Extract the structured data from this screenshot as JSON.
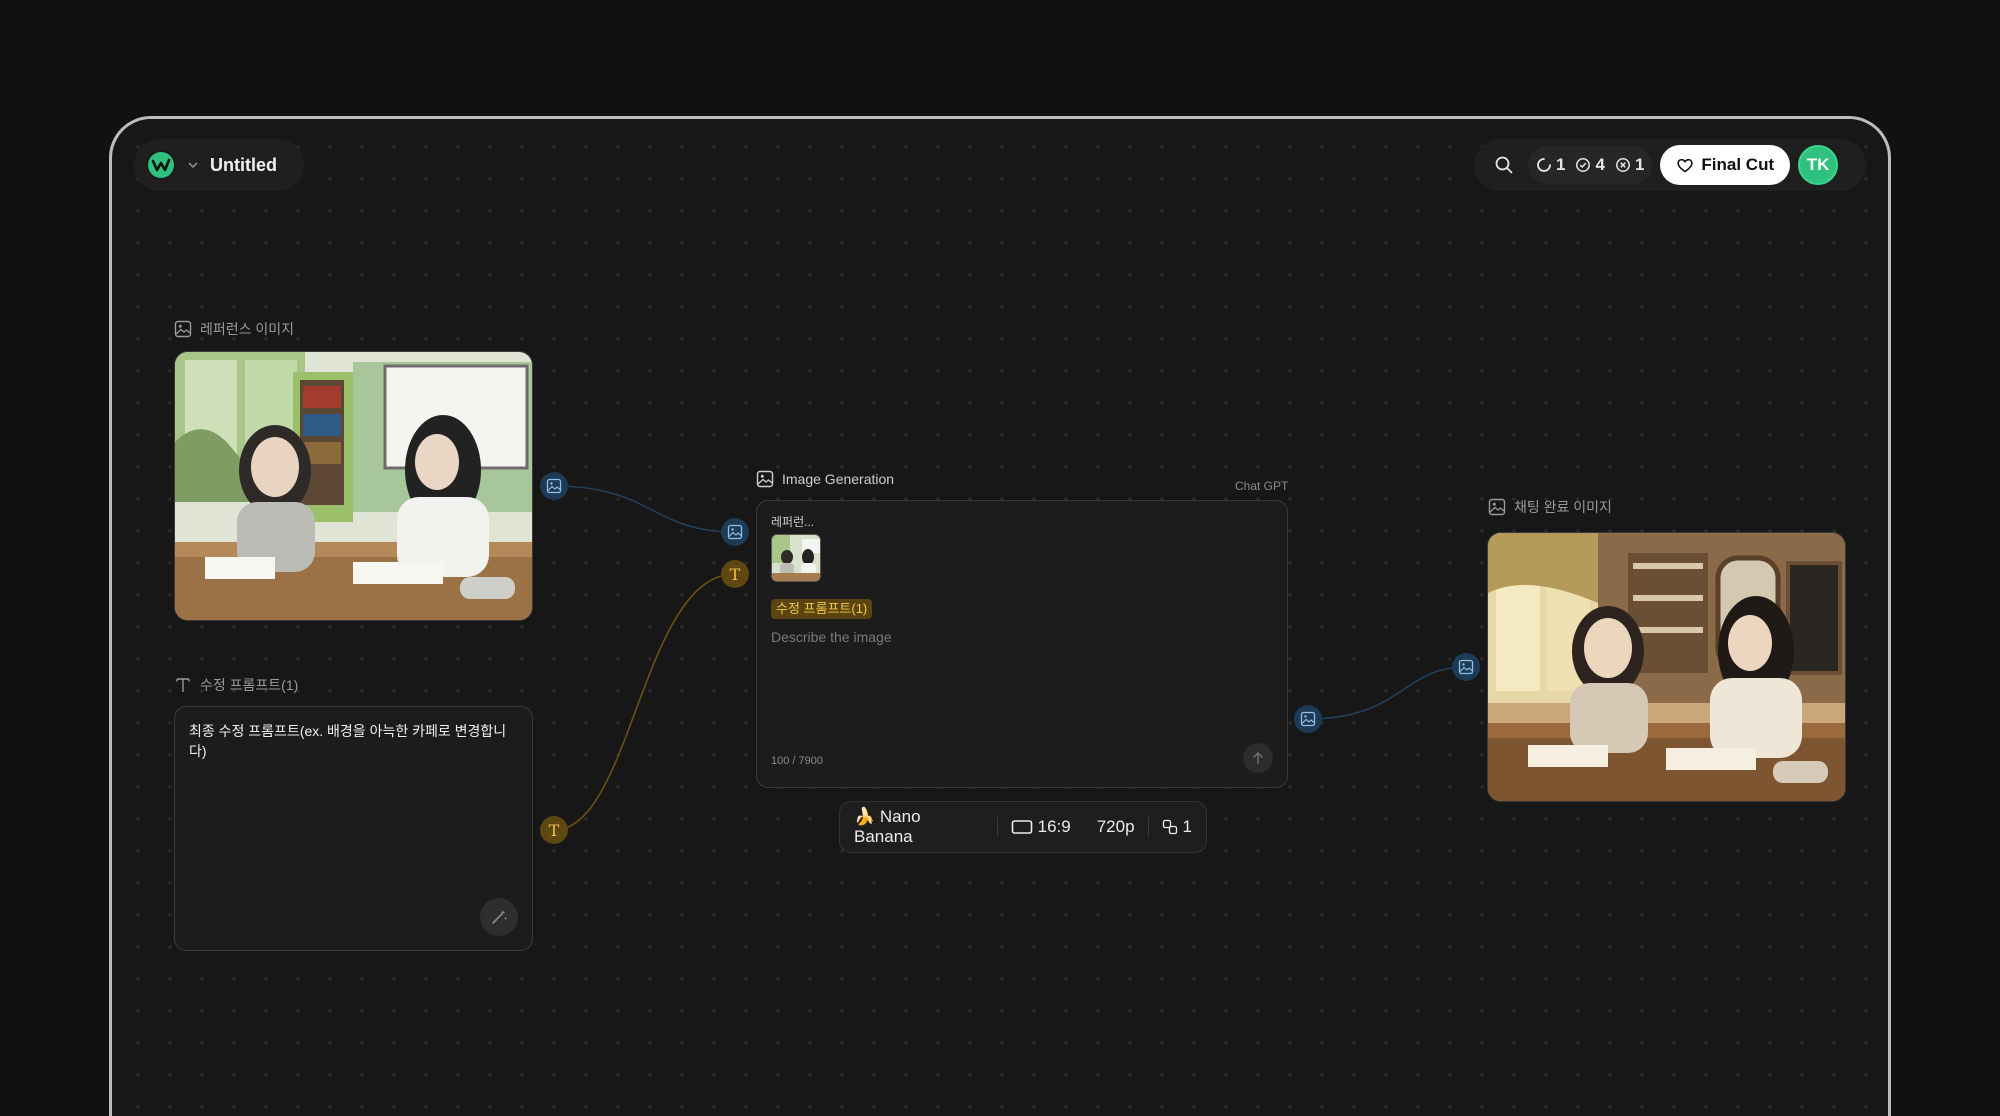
{
  "header": {
    "project_title": "Untitled",
    "stats": [
      {
        "icon": "loading-icon",
        "value": "1"
      },
      {
        "icon": "check-circle-icon",
        "value": "4"
      },
      {
        "icon": "x-circle-icon",
        "value": "1"
      }
    ],
    "final_cut_label": "Final Cut",
    "avatar_initials": "TK"
  },
  "nodes": {
    "reference_image": {
      "label": "레퍼런스 이미지"
    },
    "edit_prompt": {
      "label": "수정 프롬프트(1)",
      "text": "최종 수정 프롬프트(ex. 배경을 아늑한 카페로 변경합니다)"
    },
    "image_generation": {
      "label": "Image Generation",
      "provider": "Chat GPT",
      "ref_label": "레퍼런...",
      "prompt_tag": "수정 프롬프트(1)",
      "placeholder": "Describe the image",
      "counter": "100 / 7900"
    },
    "result_image": {
      "label": "채팅 완료 이미지"
    }
  },
  "settings": {
    "model": "🍌 Nano Banana",
    "aspect": "16:9",
    "resolution": "720p",
    "count": "1"
  },
  "colors": {
    "accent_green": "#2ec27e",
    "image_port": "#1e3b55",
    "text_port": "#5e4710",
    "tag_text": "#f4c84a"
  }
}
